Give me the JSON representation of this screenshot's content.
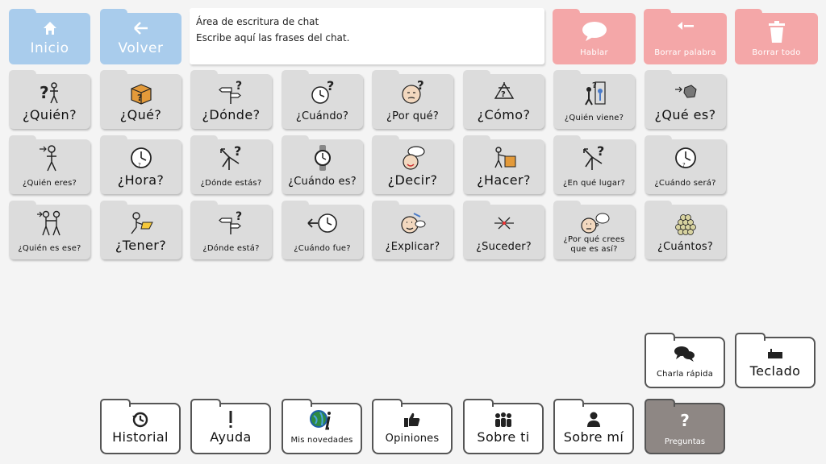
{
  "nav": {
    "home_label": "Inicio",
    "back_label": "Volver"
  },
  "chat": {
    "title": "Área de escritura de chat",
    "hint": "Escribe aquí las frases del chat."
  },
  "actions": {
    "speak_label": "Hablar",
    "delete_word_label": "Borrar palabra",
    "delete_all_label": "Borrar todo"
  },
  "grid": [
    {
      "label": "¿Quién?",
      "icon": "who-icon",
      "size": "big"
    },
    {
      "label": "¿Qué?",
      "icon": "box-icon",
      "size": "big"
    },
    {
      "label": "¿Dónde?",
      "icon": "signpost-icon",
      "size": "big"
    },
    {
      "label": "¿Cuándo?",
      "icon": "clock-question-icon",
      "size": "mid"
    },
    {
      "label": "¿Por qué?",
      "icon": "thinking-face-icon",
      "size": "mid"
    },
    {
      "label": "¿Cómo?",
      "icon": "how-icon",
      "size": "big"
    },
    {
      "label": "¿Quién viene?",
      "icon": "who-comes-icon",
      "size": "small"
    },
    {
      "label": "¿Qué es?",
      "icon": "what-is-icon",
      "size": "big"
    },
    {
      "label": "¿Quién eres?",
      "icon": "person-icon",
      "size": "small"
    },
    {
      "label": "¿Hora?",
      "icon": "clock-icon",
      "size": "big"
    },
    {
      "label": "¿Dónde estás?",
      "icon": "arrows-question-icon",
      "size": "small"
    },
    {
      "label": "¿Cuándo es?",
      "icon": "watch-icon",
      "size": "mid"
    },
    {
      "label": "¿Decir?",
      "icon": "speech-face-icon",
      "size": "big"
    },
    {
      "label": "¿Hacer?",
      "icon": "do-icon",
      "size": "big"
    },
    {
      "label": "¿En qué lugar?",
      "icon": "arrows-question-icon",
      "size": "small"
    },
    {
      "label": "¿Cuándo será?",
      "icon": "clock-icon",
      "size": "small"
    },
    {
      "label": "¿Quién es ese?",
      "icon": "two-people-icon",
      "size": "small"
    },
    {
      "label": "¿Tener?",
      "icon": "have-icon",
      "size": "big"
    },
    {
      "label": "¿Dónde está?",
      "icon": "signpost-icon",
      "size": "small"
    },
    {
      "label": "¿Cuándo fue?",
      "icon": "past-clock-icon",
      "size": "small"
    },
    {
      "label": "¿Explicar?",
      "icon": "explain-face-icon",
      "size": "mid"
    },
    {
      "label": "¿Suceder?",
      "icon": "happen-icon",
      "size": "mid"
    },
    {
      "label": "¿Por qué crees que es así?",
      "icon": "think-bubble-icon",
      "size": "two"
    },
    {
      "label": "¿Cuántos?",
      "icon": "many-balls-icon",
      "size": "mid"
    }
  ],
  "side": {
    "quick_chat_label": "Charla rápida",
    "keyboard_label": "Teclado"
  },
  "bottom": [
    {
      "label": "Historial",
      "icon": "history-icon",
      "size": "big"
    },
    {
      "label": "Ayuda",
      "icon": "exclamation-icon",
      "size": "big"
    },
    {
      "label": "Mis novedades",
      "icon": "globe-info-icon",
      "size": "small"
    },
    {
      "label": "Opiniones",
      "icon": "thumbs-up-icon",
      "size": "mid"
    },
    {
      "label": "Sobre ti",
      "icon": "group-icon",
      "size": "big"
    },
    {
      "label": "Sobre mí",
      "icon": "user-icon",
      "size": "big"
    }
  ],
  "selected_tab": {
    "label": "Preguntas",
    "glyph": "?"
  },
  "colors": {
    "nav_blue": "#a9ccec",
    "action_red": "#f4a7a8",
    "tile_gray": "#dcdcdc",
    "selected_tab": "#8e8784"
  }
}
